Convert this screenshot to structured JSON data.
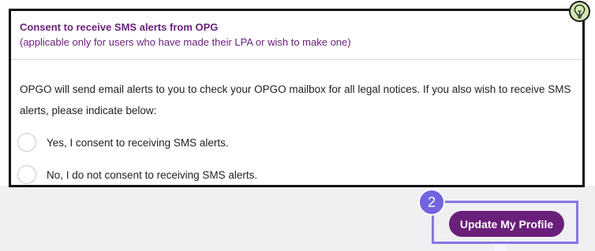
{
  "consent": {
    "title": "Consent to receive SMS alerts from OPG",
    "subtitle": "(applicable only for users who have made their LPA or wish to make one)",
    "description": "OPGO will send email alerts to you to check your OPGO mailbox for all legal notices. If you also wish to receive SMS alerts, please indicate below:",
    "options": [
      {
        "label": "Yes, I consent to receiving SMS alerts.",
        "selected": false
      },
      {
        "label": "No, I do not consent to receiving SMS alerts.",
        "selected": false
      }
    ]
  },
  "hint": {
    "icon": "lightbulb-icon"
  },
  "step": {
    "number": "2"
  },
  "actions": {
    "update_label": "Update My Profile"
  },
  "colors": {
    "brand_purple": "#6a1f7a",
    "step_accent": "#7264e0",
    "hint_green": "#cfe8b2",
    "panel_border": "#111111"
  }
}
